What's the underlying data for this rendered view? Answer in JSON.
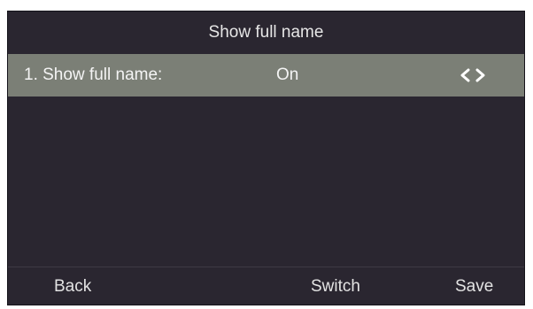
{
  "header": {
    "title": "Show full name"
  },
  "settings": {
    "items": [
      {
        "label": "1. Show full name:",
        "value": "On",
        "control_icon": "left-right-arrows-icon"
      }
    ]
  },
  "softkeys": {
    "back": "Back",
    "switch": "Switch",
    "save": "Save"
  },
  "colors": {
    "screen_background": "#2a2630",
    "selected_row": "#7b7f76",
    "text": "#f4f4f4"
  }
}
